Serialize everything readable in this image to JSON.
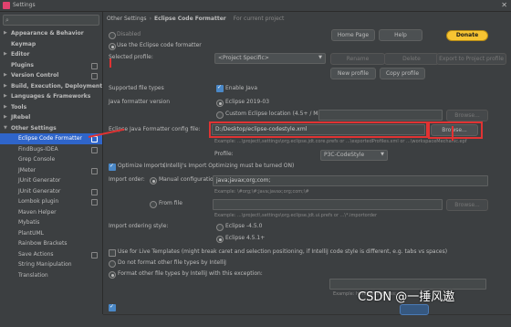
{
  "window": {
    "title": "Settings"
  },
  "sidebar": {
    "search_placeholder": "",
    "items": [
      {
        "label": "Appearance & Behavior",
        "arrow": "▶"
      },
      {
        "label": "Keymap",
        "arrow": ""
      },
      {
        "label": "Editor",
        "arrow": "▶"
      },
      {
        "label": "Plugins",
        "arrow": ""
      },
      {
        "label": "Version Control",
        "arrow": "▶"
      },
      {
        "label": "Build, Execution, Deployment",
        "arrow": "▶"
      },
      {
        "label": "Languages & Frameworks",
        "arrow": "▶"
      },
      {
        "label": "Tools",
        "arrow": "▶"
      },
      {
        "label": "JRebel",
        "arrow": "▶"
      },
      {
        "label": "Other Settings",
        "arrow": "▼"
      },
      {
        "label": "Eclipse Code Formatter",
        "arrow": ""
      },
      {
        "label": "FindBugs-IDEA",
        "arrow": ""
      },
      {
        "label": "Grep Console",
        "arrow": ""
      },
      {
        "label": "JMeter",
        "arrow": ""
      },
      {
        "label": "JUnit Generator",
        "arrow": ""
      },
      {
        "label": "JUnit Generator",
        "arrow": ""
      },
      {
        "label": "Lombok plugin",
        "arrow": ""
      },
      {
        "label": "Maven Helper",
        "arrow": ""
      },
      {
        "label": "Mybatis",
        "arrow": ""
      },
      {
        "label": "PlantUML",
        "arrow": ""
      },
      {
        "label": "Rainbow Brackets",
        "arrow": ""
      },
      {
        "label": "Save Actions",
        "arrow": ""
      },
      {
        "label": "String Manipulation",
        "arrow": ""
      },
      {
        "label": "Translation",
        "arrow": ""
      }
    ]
  },
  "breadcrumb": {
    "parent": "Other Settings",
    "separator": "›",
    "current": "Eclipse Code Formatter",
    "scope": "For current project"
  },
  "buttons": {
    "home_page": "Home Page",
    "help": "Help",
    "donate": "Donate",
    "rename": "Rename",
    "delete": "Delete",
    "export_profile": "Export to Project profile",
    "new_profile": "New profile",
    "copy_profile": "Copy profile",
    "browse_location": "Browse...",
    "browse_config": "Browse...",
    "browse_import": "Browse..."
  },
  "options": {
    "disabled": "Disabled",
    "use_eclipse": "Use the Eclipse code formatter",
    "selected_profile_label": "Selected profile:",
    "selected_profile_value": "<Project Specific>",
    "supported_file_types_label": "Supported file types",
    "enable_java": "Enable Java",
    "java_formatter_version_label": "Java formatter version",
    "eclipse_version": "Eclipse 2019-03",
    "custom_location": "Custom Eclipse location (4.5+ / Mars+)",
    "config_file_label": "Eclipse Java Formatter config file:",
    "config_file_value": "D:/Desktop/eclipse-codestyle.xml",
    "config_example": "Example: ...\\project\\.settings\\org.eclipse.jdt.core.prefs or ...\\exportedProfiles.xml or ...\\workspaceMechanic.epf",
    "profile_label": "Profile:",
    "profile_value": "P3C-CodeStyle",
    "optimize_imports": "Optimize Imports",
    "optimize_note": "(IntelliJ's Import Optimizing must be turned ON)",
    "import_order_label": "Import order:",
    "manual_configuration": "Manual configuration",
    "manual_value": "java;javax;org;com;",
    "manual_example": "Example: \\#org;\\#;java;javax;org;com;\\#",
    "from_file": "From file",
    "from_file_example": "Example: ...\\project\\.settings\\org.eclipse.jdt.ui.prefs or ...\\*.importorder",
    "ordering_style_label": "Import ordering style:",
    "eclipse_45": "Eclipse -4.5.0",
    "eclipse_451": "Eclipse 4.5.1+",
    "live_templates": "Use for Live Templates (might break caret and selection positioning, if IntelliJ code style is different, e.g. tabs vs spaces)",
    "do_not_format": "Do not format other file types by IntelliJ",
    "format_other": "Format other file types by IntelliJ with this exception:",
    "format_example": "Example: html; groovy; css;"
  },
  "watermark": "CSDN @一捶风遨",
  "colors": {
    "accent": "#2f65ca",
    "highlight": "#e03333",
    "donate": "#f7c432",
    "background": "#3c3f41"
  }
}
